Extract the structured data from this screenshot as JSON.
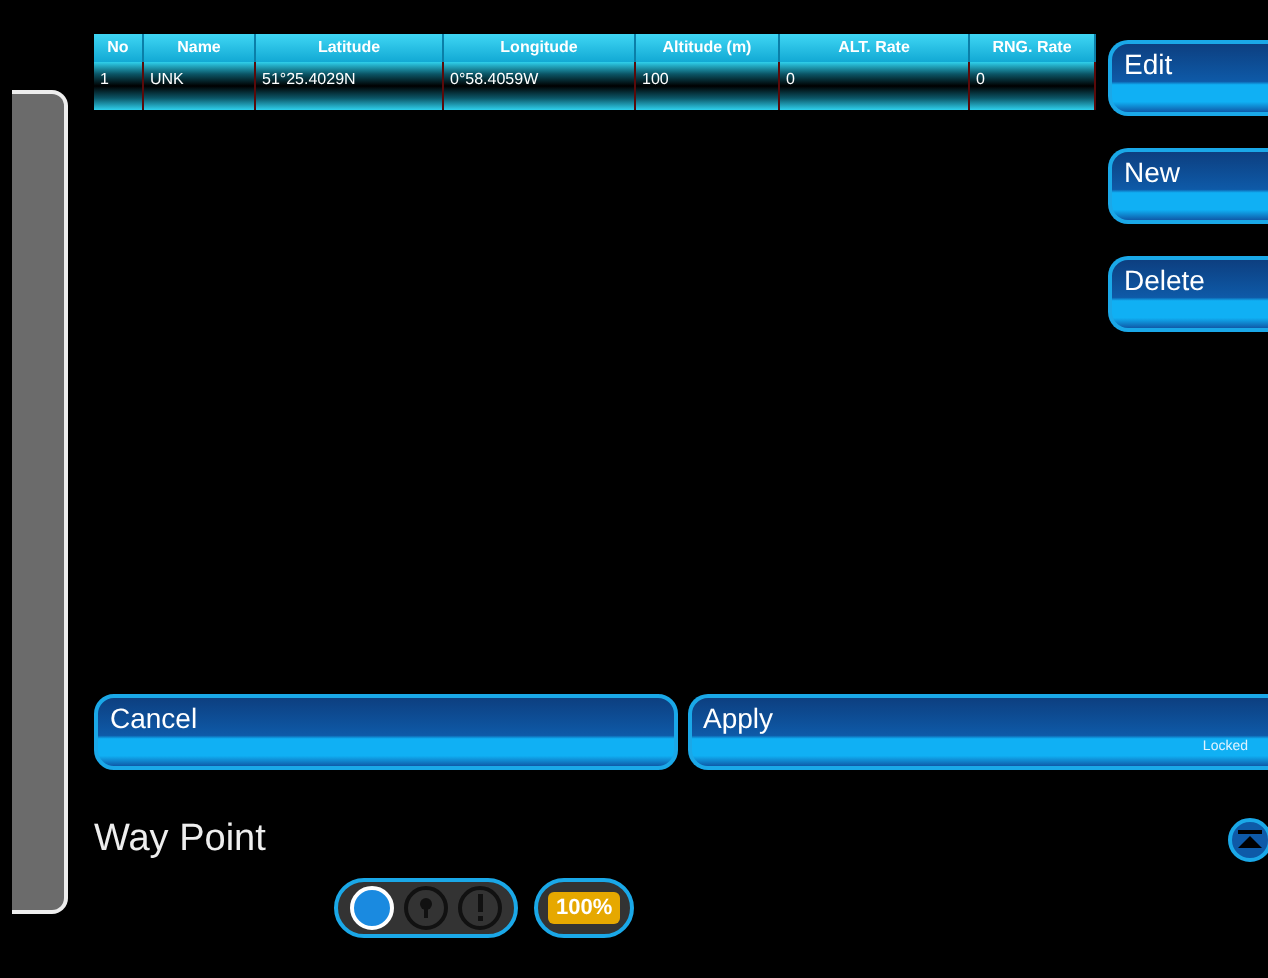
{
  "table": {
    "columns": [
      "No",
      "Name",
      "Latitude",
      "Longitude",
      "Altitude (m)",
      "ALT. Rate",
      "RNG. Rate"
    ],
    "rows": [
      [
        "1",
        "UNK",
        "51°25.4029N",
        "0°58.4059W",
        "100",
        "0",
        "0"
      ]
    ]
  },
  "side_buttons": [
    "Edit",
    "New",
    "Delete"
  ],
  "actions": [
    {
      "label": "Cancel"
    },
    {
      "label": "Apply",
      "note": "Locked"
    }
  ],
  "title": "Way Point",
  "status": {
    "indicators": [
      {
        "kind": "dot",
        "selected": true
      },
      {
        "kind": "key",
        "selected": false
      },
      {
        "kind": "alert",
        "selected": false
      }
    ],
    "battery": "100%"
  }
}
